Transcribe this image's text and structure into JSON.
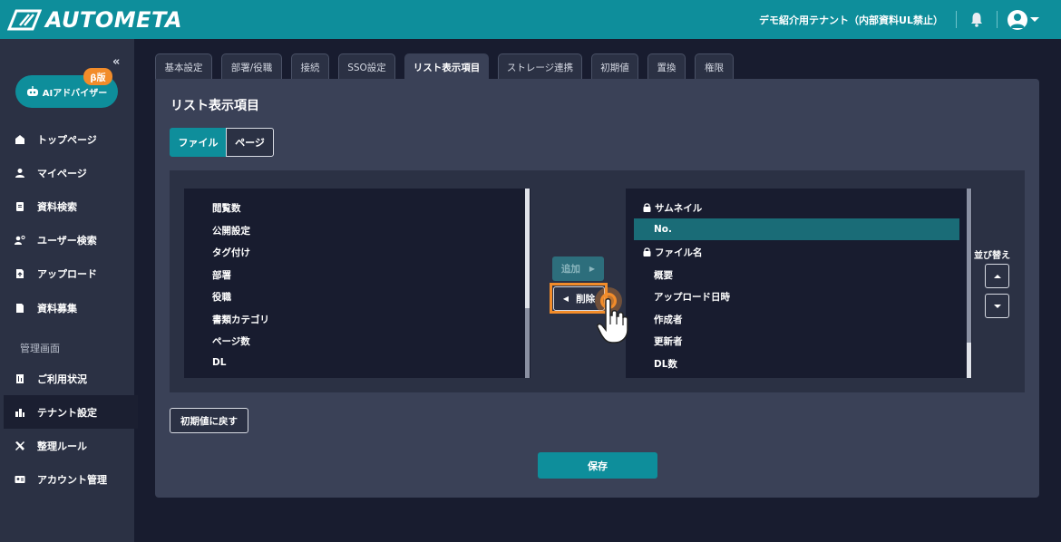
{
  "header": {
    "logo_text": "AUTOMETA",
    "tenant_name": "デモ紹介用テナント（内部資料UL禁止）",
    "icons": [
      "logo-icon",
      "bell-icon",
      "user-avatar-icon",
      "chevron-down-icon"
    ]
  },
  "sidebar": {
    "collapse_glyph": "«",
    "advisor_label": "AIアドバイザー",
    "beta_badge": "β版",
    "section_label": "管理画面",
    "items": [
      {
        "label": "トップページ",
        "icon": "home-icon"
      },
      {
        "label": "マイページ",
        "icon": "person-icon"
      },
      {
        "label": "資料検索",
        "icon": "document-search-icon"
      },
      {
        "label": "ユーザー検索",
        "icon": "user-search-icon"
      },
      {
        "label": "アップロード",
        "icon": "upload-icon"
      },
      {
        "label": "資料募集",
        "icon": "document-icon"
      },
      {
        "label": "ご利用状況",
        "icon": "usage-icon"
      },
      {
        "label": "テナント設定",
        "icon": "tenant-settings-icon",
        "active": true
      },
      {
        "label": "整理ルール",
        "icon": "tools-icon"
      },
      {
        "label": "アカウント管理",
        "icon": "id-card-icon"
      }
    ]
  },
  "tabs": [
    "基本設定",
    "部署/役職",
    "接続",
    "SSO設定",
    "リスト表示項目",
    "ストレージ連携",
    "初期値",
    "置換",
    "権限"
  ],
  "active_tab": "リスト表示項目",
  "panel": {
    "title": "リスト表示項目",
    "segment": {
      "file": "ファイル",
      "page": "ページ",
      "selected": "ファイル"
    },
    "available_items": [
      "閲覧数",
      "公開設定",
      "タグ付け",
      "部署",
      "役職",
      "書類カテゴリ",
      "ページ数",
      "DL"
    ],
    "selected_items": [
      {
        "label": "サムネイル",
        "locked": true
      },
      {
        "label": "No.",
        "locked": false,
        "highlighted": true
      },
      {
        "label": "ファイル名",
        "locked": true
      },
      {
        "label": "概要",
        "locked": false
      },
      {
        "label": "アップロード日時",
        "locked": false
      },
      {
        "label": "作成者",
        "locked": false
      },
      {
        "label": "更新者",
        "locked": false
      },
      {
        "label": "DL数",
        "locked": false
      }
    ],
    "add_label": "追加",
    "delete_label": "削除",
    "sort_label": "並び替え",
    "reset_label": "初期値に戻す",
    "save_label": "保存"
  },
  "colors": {
    "accent": "#0e8e9b",
    "highlight": "#f28c2a",
    "background": "#181c2f",
    "panel": "#3a4157",
    "sidebar": "#2b3144"
  }
}
